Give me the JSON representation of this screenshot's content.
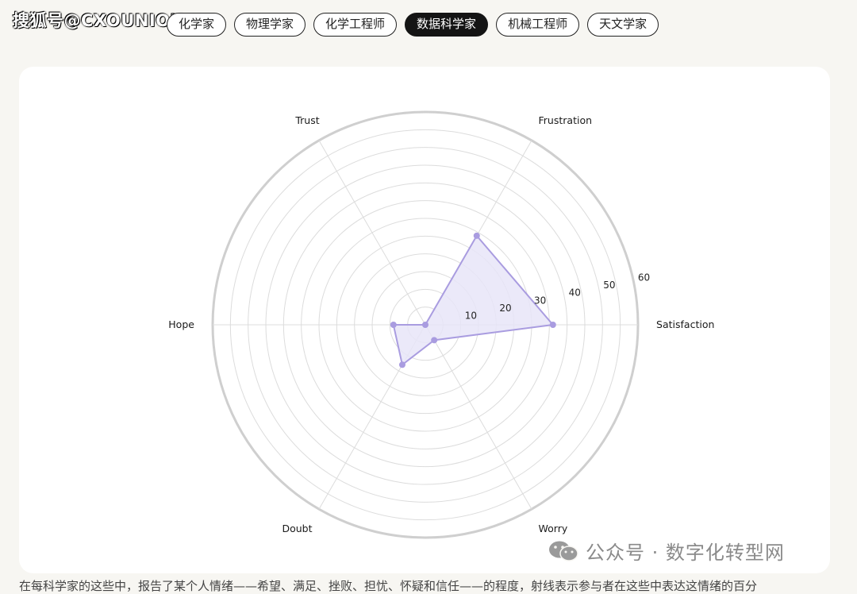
{
  "watermark_top": "搜狐号@CXOUNION",
  "tabs": [
    {
      "label": "化学家",
      "active": false
    },
    {
      "label": "物理学家",
      "active": false
    },
    {
      "label": "化学工程师",
      "active": false
    },
    {
      "label": "数据科学家",
      "active": true
    },
    {
      "label": "机械工程师",
      "active": false
    },
    {
      "label": "天文学家",
      "active": false
    }
  ],
  "chart_data": {
    "type": "radar",
    "axes": [
      "Satisfaction",
      "Frustration",
      "Trust",
      "Hope",
      "Doubt",
      "Worry"
    ],
    "values": [
      36,
      29,
      0,
      9,
      13,
      5
    ],
    "rlim": [
      0,
      60
    ],
    "ring_ticks": [
      10,
      20,
      30,
      40,
      50,
      60
    ],
    "fill_color": "#e8e5f8",
    "line_color": "#a99ce0",
    "grid_color": "#dcdcdc",
    "outer_ring_color": "#cfcfcf"
  },
  "watermark_bottom": "公众号 · 数字化转型网",
  "bottom_text": "在每科学家的这些中，报告了某个人情绪——希望、满足、挫败、担忧、怀疑和信任——的程度，射线表示参与者在这些中表达这情绪的百分"
}
